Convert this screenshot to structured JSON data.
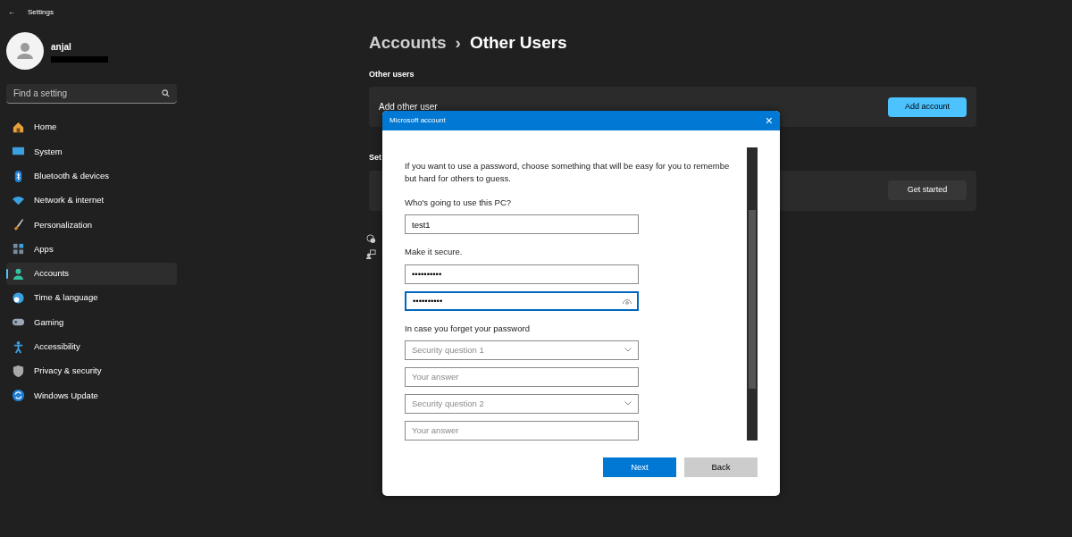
{
  "window": {
    "title": "Settings",
    "back": "←"
  },
  "user": {
    "name": "anjal"
  },
  "search": {
    "placeholder": "Find a setting"
  },
  "sidebar": {
    "items": [
      {
        "label": "Home",
        "selected": false
      },
      {
        "label": "System",
        "selected": false
      },
      {
        "label": "Bluetooth & devices",
        "selected": false
      },
      {
        "label": "Network & internet",
        "selected": false
      },
      {
        "label": "Personalization",
        "selected": false
      },
      {
        "label": "Apps",
        "selected": false
      },
      {
        "label": "Accounts",
        "selected": true
      },
      {
        "label": "Time & language",
        "selected": false
      },
      {
        "label": "Gaming",
        "selected": false
      },
      {
        "label": "Accessibility",
        "selected": false
      },
      {
        "label": "Privacy & security",
        "selected": false
      },
      {
        "label": "Windows Update",
        "selected": false
      }
    ]
  },
  "breadcrumb": {
    "parent": "Accounts",
    "separator": "›",
    "current": "Other Users"
  },
  "sections": [
    {
      "heading": "Other users",
      "card": {
        "label": "Add other user",
        "button": "Add account",
        "primary": true
      }
    },
    {
      "heading": "Set",
      "card": {
        "button": "Get started",
        "primary": false
      }
    }
  ],
  "dialog": {
    "title": "Microsoft account",
    "close": "×",
    "intro_lines": [
      "If you want to use a password, choose something that will be easy for you to remembe",
      "but hard for others to guess."
    ],
    "fields": [
      {
        "kind": "label",
        "text": "Who's going to use this PC?"
      },
      {
        "kind": "input",
        "value": "test1",
        "focused": false
      },
      {
        "kind": "label",
        "text": "Make it secure."
      },
      {
        "kind": "input",
        "value": "••••••••••",
        "focused": false
      },
      {
        "kind": "password",
        "value": "••••••••••",
        "focused": true
      },
      {
        "kind": "label",
        "text": "In case you forget your password"
      },
      {
        "kind": "select",
        "placeholder": "Security question 1"
      },
      {
        "kind": "input",
        "placeholder": "Your answer",
        "focused": false
      },
      {
        "kind": "select",
        "placeholder": "Security question 2"
      },
      {
        "kind": "input",
        "placeholder": "Your answer",
        "focused": false
      }
    ],
    "buttons": [
      {
        "label": "Next",
        "primary": true
      },
      {
        "label": "Back",
        "primary": false
      }
    ]
  }
}
